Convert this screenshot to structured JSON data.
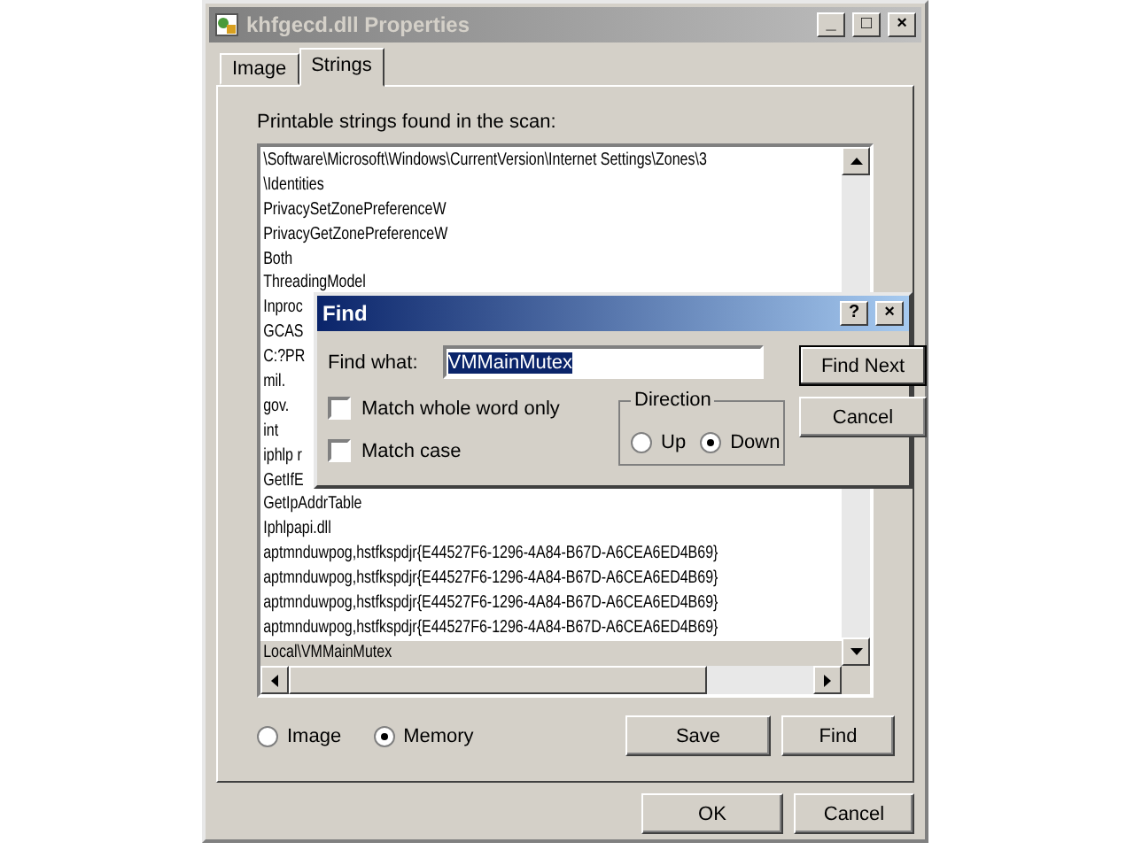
{
  "window": {
    "title": "khfgecd.dll Properties",
    "controls": [
      "_",
      "□",
      "×"
    ]
  },
  "tabs": [
    {
      "label": "Image",
      "selected": false
    },
    {
      "label": "Strings",
      "selected": true
    }
  ],
  "list_label": "Printable strings found in the scan:",
  "strings": [
    {
      "text": "\\Software\\Microsoft\\Windows\\CurrentVersion\\Internet Settings\\Zones\\3",
      "selected": false
    },
    {
      "text": "\\Identities",
      "selected": false
    },
    {
      "text": "PrivacySetZonePreferenceW",
      "selected": false
    },
    {
      "text": "PrivacyGetZonePreferenceW",
      "selected": false
    },
    {
      "text": "Both",
      "selected": false
    },
    {
      "text": "ThreadingModel",
      "selected": false
    },
    {
      "text": "Inproc",
      "selected": false
    },
    {
      "text": "GCAS",
      "selected": false
    },
    {
      "text": "C:?PR",
      "selected": false
    },
    {
      "text": "mil.",
      "selected": false
    },
    {
      "text": "gov.",
      "selected": false
    },
    {
      "text": "int",
      "selected": false
    },
    {
      "text": "iphlp r",
      "selected": false
    },
    {
      "text": "GetIfE",
      "selected": false
    },
    {
      "text": "GetIpAddrTable",
      "selected": false
    },
    {
      "text": "Iphlpapi.dll",
      "selected": false
    },
    {
      "text": "aptmnduwpog,hstfkspdjr{E44527F6-1296-4A84-B67D-A6CEA6ED4B69}",
      "selected": false
    },
    {
      "text": "aptmnduwpog,hstfkspdjr{E44527F6-1296-4A84-B67D-A6CEA6ED4B69}",
      "selected": false
    },
    {
      "text": "aptmnduwpog,hstfkspdjr{E44527F6-1296-4A84-B67D-A6CEA6ED4B69}",
      "selected": false
    },
    {
      "text": "aptmnduwpog,hstfkspdjr{E44527F6-1296-4A84-B67D-A6CEA6ED4B69}",
      "selected": false
    },
    {
      "text": "Local\\VMMainMutex",
      "selected": true
    }
  ],
  "source": [
    {
      "label": "Image",
      "selected": false
    },
    {
      "label": "Memory",
      "selected": true
    }
  ],
  "panel_buttons": [
    "Save",
    "Find"
  ],
  "dialog_buttons": [
    "OK",
    "Cancel"
  ],
  "find": {
    "title": "Find",
    "controls": [
      "?",
      "×"
    ],
    "label": "Find what:",
    "value": "VMMainMutex",
    "options": [
      {
        "label": "Match whole word only",
        "checked": false
      },
      {
        "label": "Match case",
        "checked": false
      }
    ],
    "direction": {
      "title": "Direction",
      "options": [
        {
          "label": "Up",
          "selected": false
        },
        {
          "label": "Down",
          "selected": true
        }
      ]
    },
    "buttons": [
      "Find Next",
      "Cancel"
    ]
  }
}
